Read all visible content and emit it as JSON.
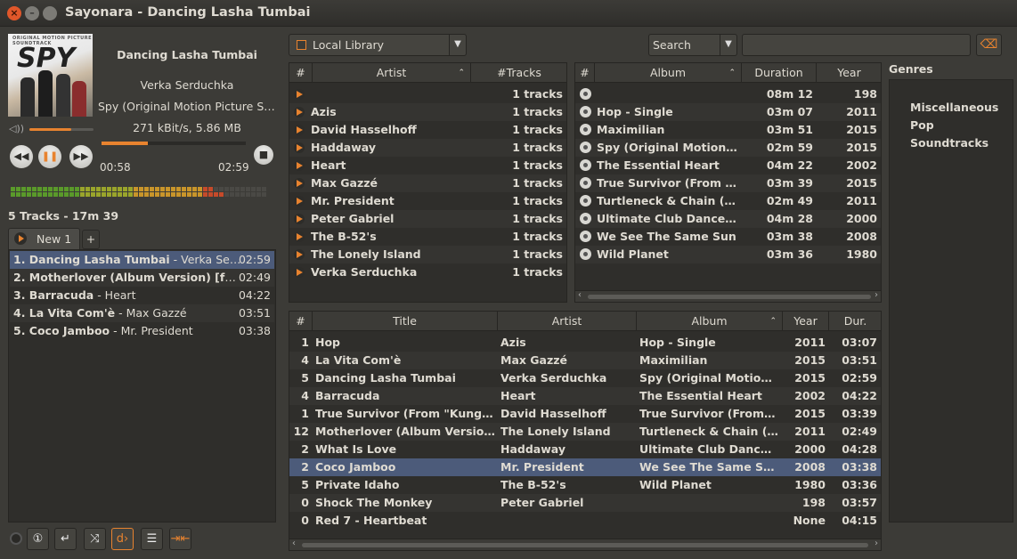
{
  "window": {
    "title": "Sayonara - Dancing Lasha Tumbai"
  },
  "cover": {
    "small_text": "ORIGINAL MOTION PICTURE SOUNDTRACK",
    "big_text": "SPY"
  },
  "now_playing": {
    "title": "Dancing Lasha Tumbai",
    "artist": "Verka Serduchka",
    "album": "Spy (Original Motion Picture So...",
    "bitrate": "271 kBit/s, 5.86 MB",
    "elapsed": "00:58",
    "total": "02:59",
    "progress": 0.32,
    "volume": 0.65
  },
  "playlist": {
    "summary": "5 Tracks - 17m 39",
    "tab_label": "New 1",
    "add_tab": "+",
    "items": [
      {
        "title": "1. Dancing Lasha Tumbai",
        "artist": " - Verka Serduc...",
        "duration": "02:59"
      },
      {
        "title": "2. Motherlover (Album Version) [feat. ...",
        "artist": "",
        "duration": "02:49"
      },
      {
        "title": "3. Barracuda",
        "artist": " - Heart",
        "duration": "04:22"
      },
      {
        "title": "4. La Vita Com'è",
        "artist": " - Max Gazzé",
        "duration": "03:51"
      },
      {
        "title": "5. Coco Jamboo",
        "artist": " - Mr. President",
        "duration": "03:38"
      }
    ]
  },
  "toolbar": {
    "source": "Local Library",
    "search_mode": "Search",
    "search_value": ""
  },
  "artists": {
    "headers": {
      "num": "#",
      "artist": "Artist",
      "tracks": "#Tracks"
    },
    "rows": [
      {
        "name": "",
        "tracks": "1 tracks"
      },
      {
        "name": "Azis",
        "tracks": "1 tracks"
      },
      {
        "name": "David Hasselhoff",
        "tracks": "1 tracks"
      },
      {
        "name": "Haddaway",
        "tracks": "1 tracks"
      },
      {
        "name": "Heart",
        "tracks": "1 tracks"
      },
      {
        "name": "Max Gazzé",
        "tracks": "1 tracks"
      },
      {
        "name": "Mr. President",
        "tracks": "1 tracks"
      },
      {
        "name": "Peter Gabriel",
        "tracks": "1 tracks"
      },
      {
        "name": "The B-52's",
        "tracks": "1 tracks"
      },
      {
        "name": "The Lonely Island",
        "tracks": "1 tracks"
      },
      {
        "name": "Verka Serduchka",
        "tracks": "1 tracks"
      }
    ]
  },
  "albums": {
    "headers": {
      "num": "#",
      "album": "Album",
      "duration": "Duration",
      "year": "Year"
    },
    "rows": [
      {
        "name": "",
        "duration": "08m 12",
        "year": "198"
      },
      {
        "name": "Hop - Single",
        "duration": "03m 07",
        "year": "2011"
      },
      {
        "name": "Maximilian",
        "duration": "03m 51",
        "year": "2015"
      },
      {
        "name": "Spy (Original Motion P...",
        "duration": "02m 59",
        "year": "2015"
      },
      {
        "name": "The Essential Heart",
        "duration": "04m 22",
        "year": "2002"
      },
      {
        "name": "True Survivor (From \"K...",
        "duration": "03m 39",
        "year": "2015"
      },
      {
        "name": "Turtleneck & Chain (Ex...",
        "duration": "02m 49",
        "year": "2011"
      },
      {
        "name": "Ultimate Club Dance 9...",
        "duration": "04m 28",
        "year": "2000"
      },
      {
        "name": "We See The Same Sun",
        "duration": "03m 38",
        "year": "2008"
      },
      {
        "name": "Wild Planet",
        "duration": "03m 36",
        "year": "1980"
      }
    ]
  },
  "tracks": {
    "headers": {
      "num": "#",
      "title": "Title",
      "artist": "Artist",
      "album": "Album",
      "year": "Year",
      "dur": "Dur."
    },
    "rows": [
      {
        "num": "1",
        "title": "Hop",
        "artist": "Azis",
        "album": "Hop - Single",
        "year": "2011",
        "dur": "03:07"
      },
      {
        "num": "4",
        "title": "La Vita Com'è",
        "artist": "Max Gazzé",
        "album": "Maximilian",
        "year": "2015",
        "dur": "03:51"
      },
      {
        "num": "5",
        "title": "Dancing Lasha Tumbai",
        "artist": "Verka Serduchka",
        "album": "Spy (Original Motion Pi...",
        "year": "2015",
        "dur": "02:59"
      },
      {
        "num": "4",
        "title": "Barracuda",
        "artist": "Heart",
        "album": "The Essential Heart",
        "year": "2002",
        "dur": "04:22"
      },
      {
        "num": "1",
        "title": "True Survivor (From \"Kung Fur...",
        "artist": "David Hasselhoff",
        "album": "True Survivor (From \"K...",
        "year": "2015",
        "dur": "03:39"
      },
      {
        "num": "12",
        "title": "Motherlover (Album Version) [...",
        "artist": "The Lonely Island",
        "album": "Turtleneck & Chain (Ex...",
        "year": "2011",
        "dur": "02:49"
      },
      {
        "num": "2",
        "title": "What Is Love",
        "artist": "Haddaway",
        "album": "Ultimate Club Dance 9...",
        "year": "2000",
        "dur": "04:28"
      },
      {
        "num": "2",
        "title": "Coco Jamboo",
        "artist": "Mr. President",
        "album": "We See The Same Sun",
        "year": "2008",
        "dur": "03:38"
      },
      {
        "num": "5",
        "title": "Private Idaho",
        "artist": "The B-52's",
        "album": "Wild Planet",
        "year": "1980",
        "dur": "03:36"
      },
      {
        "num": "0",
        "title": "Shock The Monkey",
        "artist": "Peter Gabriel",
        "album": "",
        "year": "198",
        "dur": "03:57"
      },
      {
        "num": "0",
        "title": "Red 7 - Heartbeat",
        "artist": "",
        "album": "",
        "year": "None",
        "dur": "04:15"
      }
    ]
  },
  "genres": {
    "label": "Genres",
    "items": [
      "Miscellaneous",
      "Pop",
      "Soundtracks"
    ]
  },
  "colors": {
    "accent": "#e8832f",
    "selection": "#4c5b7a"
  }
}
